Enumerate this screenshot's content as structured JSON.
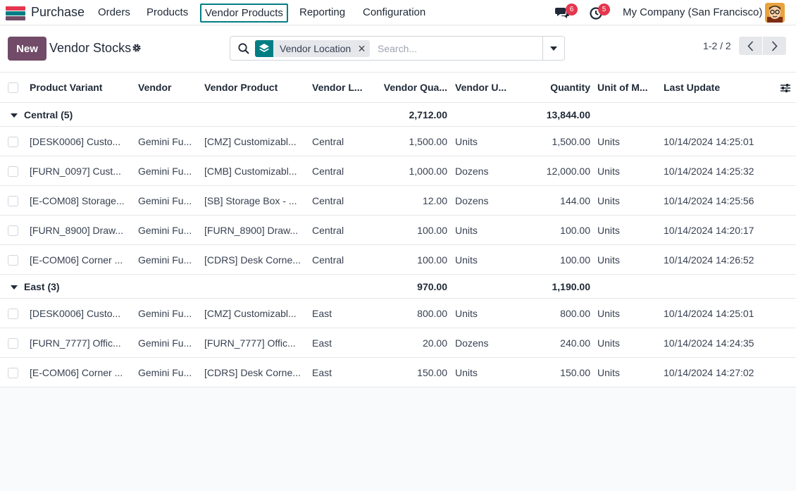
{
  "navbar": {
    "app_name": "Purchase",
    "menu": [
      "Orders",
      "Products",
      "Vendor Products",
      "Reporting",
      "Configuration"
    ],
    "active_menu": "Vendor Products",
    "messages_count": "6",
    "activities_count": "5",
    "company": "My Company (San Francisco)",
    "brand_colors": [
      "#e4374f",
      "#f3a712",
      "#017e84",
      "#714b67"
    ]
  },
  "control": {
    "new_label": "New",
    "title": "Vendor Stocks",
    "facet_label": "Vendor Location",
    "search_placeholder": "Search...",
    "pager": "1-2 / 2",
    "accent": "#714b67",
    "facet_color": "#017e84"
  },
  "table": {
    "headers": {
      "product_variant": "Product Variant",
      "vendor": "Vendor",
      "vendor_product": "Vendor Product",
      "vendor_location": "Vendor L...",
      "vendor_quantity": "Vendor Qua...",
      "vendor_uom": "Vendor U...",
      "quantity": "Quantity",
      "uom": "Unit of M...",
      "last_update": "Last Update"
    },
    "groups": [
      {
        "name": "Central (5)",
        "vendor_quantity": "2,712.00",
        "quantity": "13,844.00",
        "rows": [
          {
            "product_variant": "[DESK0006] Custo...",
            "vendor": "Gemini Fu...",
            "vendor_product": "[CMZ] Customizabl...",
            "vendor_location": "Central",
            "vendor_quantity": "1,500.00",
            "vendor_uom": "Units",
            "quantity": "1,500.00",
            "uom": "Units",
            "last_update": "10/14/2024 14:25:01"
          },
          {
            "product_variant": "[FURN_0097] Cust...",
            "vendor": "Gemini Fu...",
            "vendor_product": "[CMB] Customizabl...",
            "vendor_location": "Central",
            "vendor_quantity": "1,000.00",
            "vendor_uom": "Dozens",
            "quantity": "12,000.00",
            "uom": "Units",
            "last_update": "10/14/2024 14:25:32"
          },
          {
            "product_variant": "[E-COM08] Storage...",
            "vendor": "Gemini Fu...",
            "vendor_product": "[SB] Storage Box - ...",
            "vendor_location": "Central",
            "vendor_quantity": "12.00",
            "vendor_uom": "Dozens",
            "quantity": "144.00",
            "uom": "Units",
            "last_update": "10/14/2024 14:25:56"
          },
          {
            "product_variant": "[FURN_8900] Draw...",
            "vendor": "Gemini Fu...",
            "vendor_product": "[FURN_8900] Draw...",
            "vendor_location": "Central",
            "vendor_quantity": "100.00",
            "vendor_uom": "Units",
            "quantity": "100.00",
            "uom": "Units",
            "last_update": "10/14/2024 14:20:17"
          },
          {
            "product_variant": "[E-COM06] Corner ...",
            "vendor": "Gemini Fu...",
            "vendor_product": "[CDRS] Desk Corne...",
            "vendor_location": "Central",
            "vendor_quantity": "100.00",
            "vendor_uom": "Units",
            "quantity": "100.00",
            "uom": "Units",
            "last_update": "10/14/2024 14:26:52"
          }
        ]
      },
      {
        "name": "East (3)",
        "vendor_quantity": "970.00",
        "quantity": "1,190.00",
        "rows": [
          {
            "product_variant": "[DESK0006] Custo...",
            "vendor": "Gemini Fu...",
            "vendor_product": "[CMZ] Customizabl...",
            "vendor_location": "East",
            "vendor_quantity": "800.00",
            "vendor_uom": "Units",
            "quantity": "800.00",
            "uom": "Units",
            "last_update": "10/14/2024 14:25:01"
          },
          {
            "product_variant": "[FURN_7777] Offic...",
            "vendor": "Gemini Fu...",
            "vendor_product": "[FURN_7777] Offic...",
            "vendor_location": "East",
            "vendor_quantity": "20.00",
            "vendor_uom": "Dozens",
            "quantity": "240.00",
            "uom": "Units",
            "last_update": "10/14/2024 14:24:35"
          },
          {
            "product_variant": "[E-COM06] Corner ...",
            "vendor": "Gemini Fu...",
            "vendor_product": "[CDRS] Desk Corne...",
            "vendor_location": "East",
            "vendor_quantity": "150.00",
            "vendor_uom": "Units",
            "quantity": "150.00",
            "uom": "Units",
            "last_update": "10/14/2024 14:27:02"
          }
        ]
      }
    ]
  },
  "icons": {
    "app": "purchase-app-icon",
    "messages": "chat-bubbles-icon",
    "activities": "clock-icon",
    "settings": "gear-icon",
    "search": "search-icon",
    "facet": "layers-icon",
    "remove_facet": "close-icon",
    "toggle": "caret-down-icon",
    "prev": "chevron-left-icon",
    "next": "chevron-right-icon",
    "columns": "sliders-icon"
  }
}
